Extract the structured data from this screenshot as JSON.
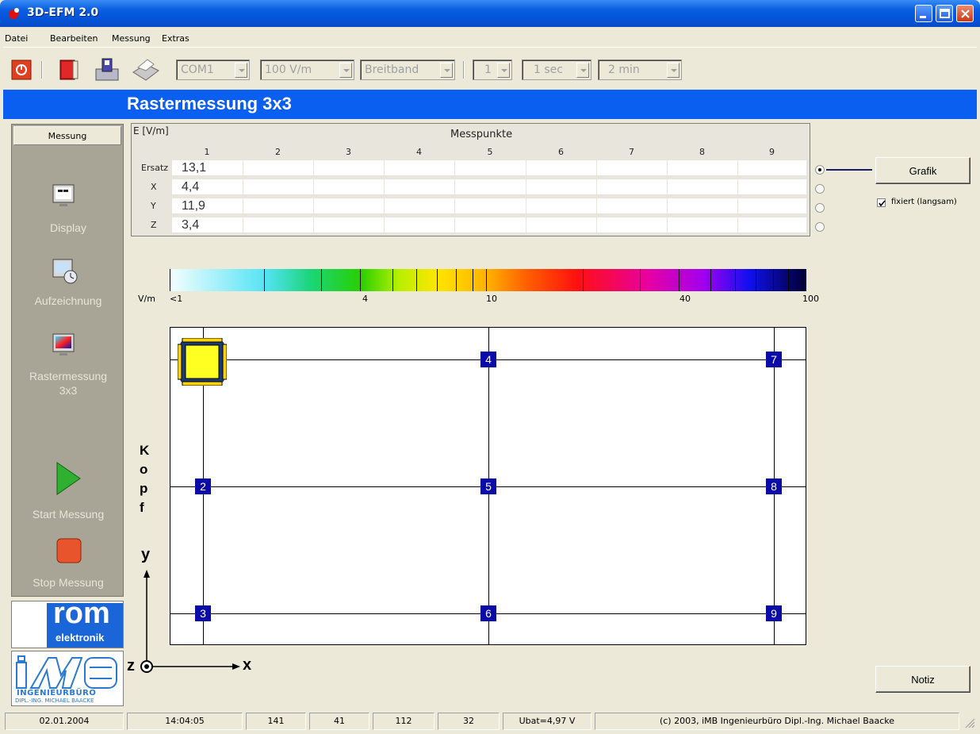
{
  "window": {
    "title": "3D-EFM 2.0"
  },
  "menu": {
    "items": [
      "Datei",
      "Bearbeiten",
      "Messung",
      "Extras"
    ]
  },
  "toolbar": {
    "port": "COM1",
    "range": "100 V/m",
    "band": "Breitband",
    "count": "1",
    "interval": "1 sec",
    "duration": "2 min"
  },
  "header": {
    "title": "Rastermessung 3x3"
  },
  "sidebar": {
    "tab": "Messung",
    "items": [
      {
        "label": "Display",
        "icon": "monitor-icon"
      },
      {
        "label": "Aufzeichnung",
        "icon": "recording-clock-icon"
      },
      {
        "label": "Rastermessung",
        "label2": "3x3",
        "icon": "raster-monitor-icon"
      },
      {
        "label": "Start Messung",
        "icon": "play-icon"
      },
      {
        "label": "Stop Messung",
        "icon": "stop-icon"
      }
    ]
  },
  "logos": {
    "rom": "rom",
    "rom_sub": "elektronik",
    "imb_line1": "INGENIEURBÜRO",
    "imb_line2": "DIPL.-ING. MICHAEL BAACKE"
  },
  "table": {
    "unit": "E [V/m]",
    "title": "Messpunkte",
    "columns": [
      "1",
      "2",
      "3",
      "4",
      "5",
      "6",
      "7",
      "8",
      "9"
    ],
    "rows": [
      {
        "label": "Ersatz",
        "values": [
          "13,1",
          "",
          "",
          "",
          "",
          "",
          "",
          "",
          ""
        ]
      },
      {
        "label": "X",
        "values": [
          "4,4",
          "",
          "",
          "",
          "",
          "",
          "",
          "",
          ""
        ]
      },
      {
        "label": "Y",
        "values": [
          "11,9",
          "",
          "",
          "",
          "",
          "",
          "",
          "",
          ""
        ]
      },
      {
        "label": "Z",
        "values": [
          "3,4",
          "",
          "",
          "",
          "",
          "",
          "",
          "",
          ""
        ]
      }
    ],
    "selected_row": 0
  },
  "controls": {
    "grafik": "Grafik",
    "fix_label": "fixiert (langsam)",
    "fix_checked": true,
    "notiz": "Notiz"
  },
  "scale": {
    "unit": "V/m",
    "labels": [
      "<1",
      "4",
      "10",
      "40",
      "100"
    ]
  },
  "grid": {
    "points": [
      "2",
      "3",
      "4",
      "5",
      "6",
      "7",
      "8",
      "9"
    ],
    "head_label": [
      "K",
      "o",
      "p",
      "f"
    ],
    "axis_y": "y",
    "axis_x": "x",
    "axis_z": "z"
  },
  "status": {
    "date": "02.01.2004",
    "time": "14:04:05",
    "v1": "141",
    "v2": "41",
    "v3": "112",
    "v4": "32",
    "ubat": "Ubat=4,97 V",
    "copyright": "(c) 2003,  iMB  Ingenieurbüro Dipl.-Ing. Michael Baacke"
  },
  "colors": {
    "accent": "#0a5ff0",
    "point": "#0a0aa8",
    "sidebar": "#a8a496"
  }
}
